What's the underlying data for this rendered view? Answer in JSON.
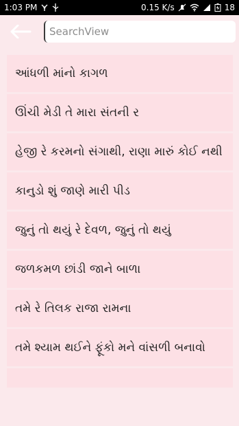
{
  "status": {
    "time": "1:03 PM",
    "speed": "0.15 K/s",
    "battery": "18"
  },
  "search": {
    "placeholder": "SearchView",
    "value": ""
  },
  "items": [
    "આંધળી માંનો કાગળ",
    "ઊંચી મેડી તે મારા સંતની ર",
    "હેજી રે કરમનો સંગાથી, રાણા મારું કોઈ નથી",
    "કાનુડો શું જાણે મારી પીડ",
    "જુનું તો થયું રે દેવળ, જુનું તો થયું",
    "જળકમળ છાંડી જાને બાળા",
    "તમે રે તિલક રાજા રામના",
    "તમે શ્યામ થઈને ફૂંકો મને વાંસળી બનાવો",
    ""
  ],
  "colors": {
    "background": "#fbe9ec",
    "item": "#fde0e5"
  }
}
